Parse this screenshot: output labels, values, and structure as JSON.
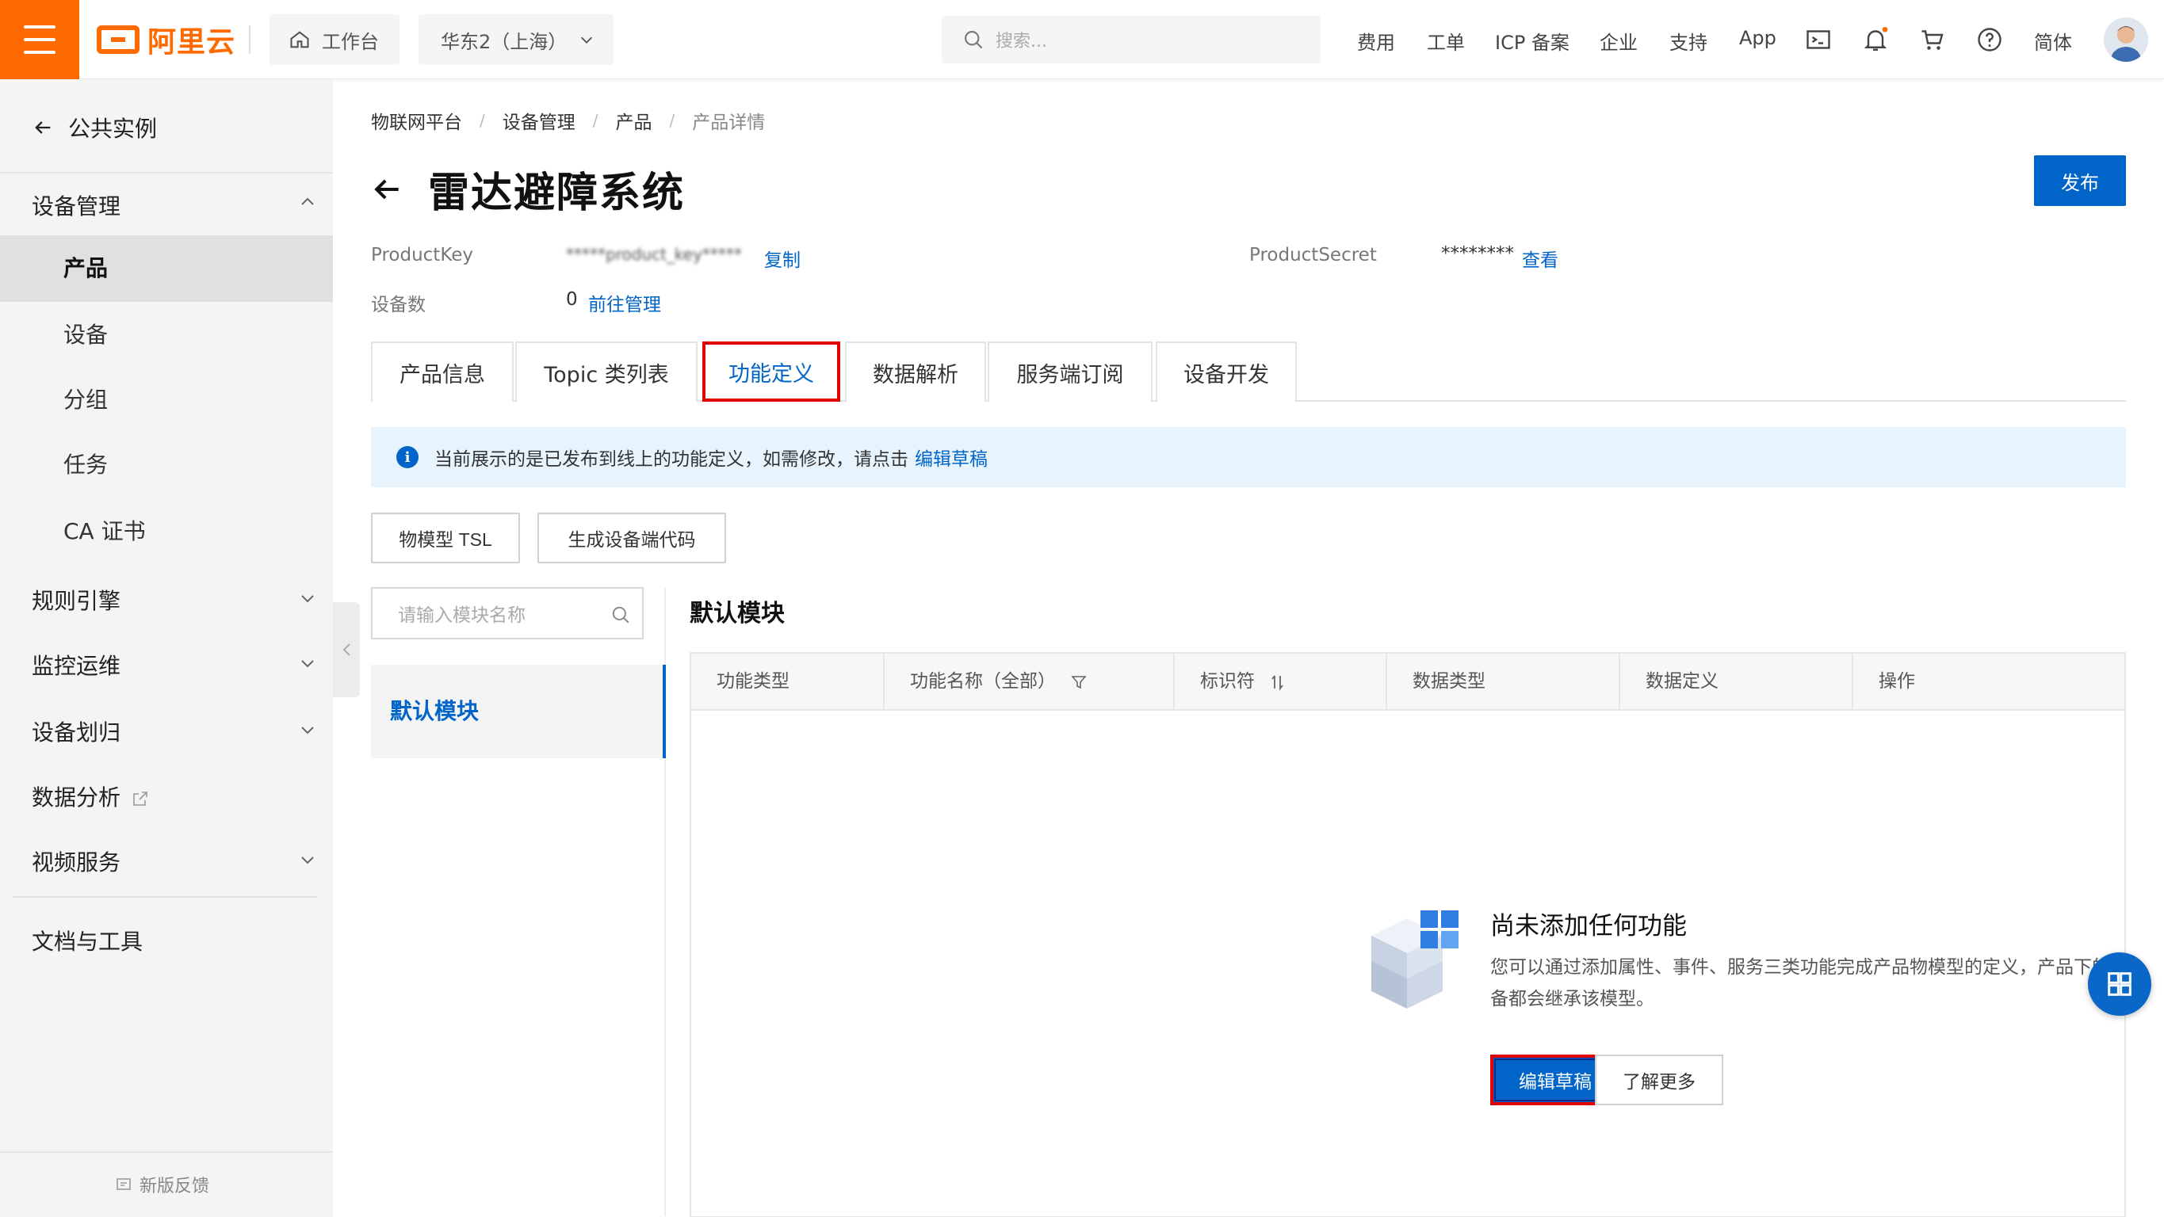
{
  "topbar": {
    "logo_text": "阿里云",
    "workbench": "工作台",
    "region": "华东2（上海）",
    "search_placeholder": "搜索...",
    "nav": [
      "费用",
      "工单",
      "ICP 备案",
      "企业",
      "支持",
      "App"
    ],
    "lang": "简体",
    "accent": "#ff6a00"
  },
  "sidebar": {
    "back_label": "公共实例",
    "groups": {
      "device_mgmt": "设备管理",
      "rules": "规则引擎",
      "monitor": "监控运维",
      "assign": "设备划归",
      "analysis": "数据分析",
      "video": "视频服务",
      "docs": "文档与工具"
    },
    "items": [
      "产品",
      "设备",
      "分组",
      "任务",
      "CA 证书"
    ],
    "feedback": "新版反馈"
  },
  "main": {
    "breadcrumb": [
      "物联网平台",
      "设备管理",
      "产品",
      "产品详情"
    ],
    "title": "雷达避障系统",
    "publish": "发布",
    "product_key_label": "ProductKey",
    "product_key_value": "*****product_key*****",
    "copy": "复制",
    "product_secret_label": "ProductSecret",
    "product_secret_value": "********",
    "view": "查看",
    "device_count_label": "设备数",
    "device_count_value": "0",
    "manage_link": "前往管理",
    "tabs": [
      "产品信息",
      "Topic 类列表",
      "功能定义",
      "数据解析",
      "服务端订阅",
      "设备开发"
    ],
    "notice_text": "当前展示的是已发布到线上的功能定义，如需修改，请点击",
    "notice_link": "编辑草稿",
    "btn_tsl": "物模型 TSL",
    "btn_gen": "生成设备端代码",
    "module_search_placeholder": "请输入模块名称",
    "module_item": "默认模块",
    "section_title": "默认模块",
    "columns": [
      "功能类型",
      "功能名称（全部）",
      "标识符",
      "数据类型",
      "数据定义",
      "操作"
    ],
    "empty_title": "尚未添加任何功能",
    "empty_desc": "您可以通过添加属性、事件、服务三类功能完成产品物模型的定义，产品下的设备都会继承该模型。",
    "edit_draft": "编辑草稿",
    "learn_more": "了解更多",
    "link_color": "#0064c8"
  }
}
